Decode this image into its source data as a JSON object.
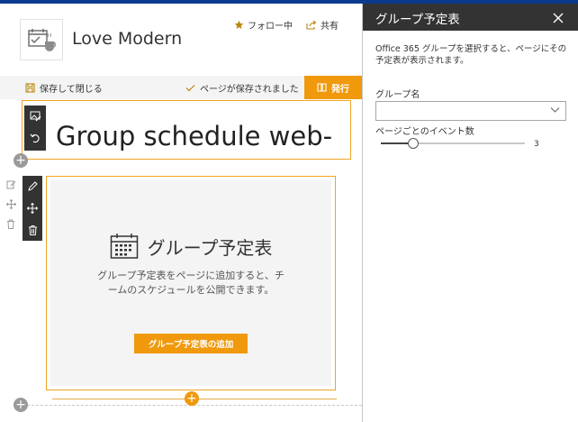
{
  "site": {
    "title": "Love Modern",
    "follow_label": "フォロー中",
    "share_label": "共有"
  },
  "command_bar": {
    "save_close_label": "保存して閉じる",
    "status_label": "ページが保存されました",
    "publish_label": "発行"
  },
  "page": {
    "title": "Group schedule web-"
  },
  "webpart": {
    "heading": "グループ予定表",
    "description": "グループ予定表をページに追加すると、チームのスケジュールを公開できます。",
    "add_button_label": "グループ予定表の追加"
  },
  "panel": {
    "title": "グループ予定表",
    "description": "Office 365 グループを選択すると、ページにその予定表が表示されます。",
    "group_name_label": "グループ名",
    "group_name_value": "",
    "events_label": "ページごとのイベント数",
    "events_value": "3",
    "events_min": 1,
    "events_max": 10
  },
  "colors": {
    "accent": "#f0990c",
    "header_dark": "#333333",
    "topbar": "#0b3a8f"
  },
  "icons": [
    "calendar-icon",
    "star-icon",
    "share-icon",
    "save-icon",
    "checkmark-icon",
    "book-icon",
    "image-edit-icon",
    "undo-icon",
    "pencil-icon",
    "move-icon",
    "trash-icon",
    "close-icon",
    "chevron-down-icon"
  ]
}
